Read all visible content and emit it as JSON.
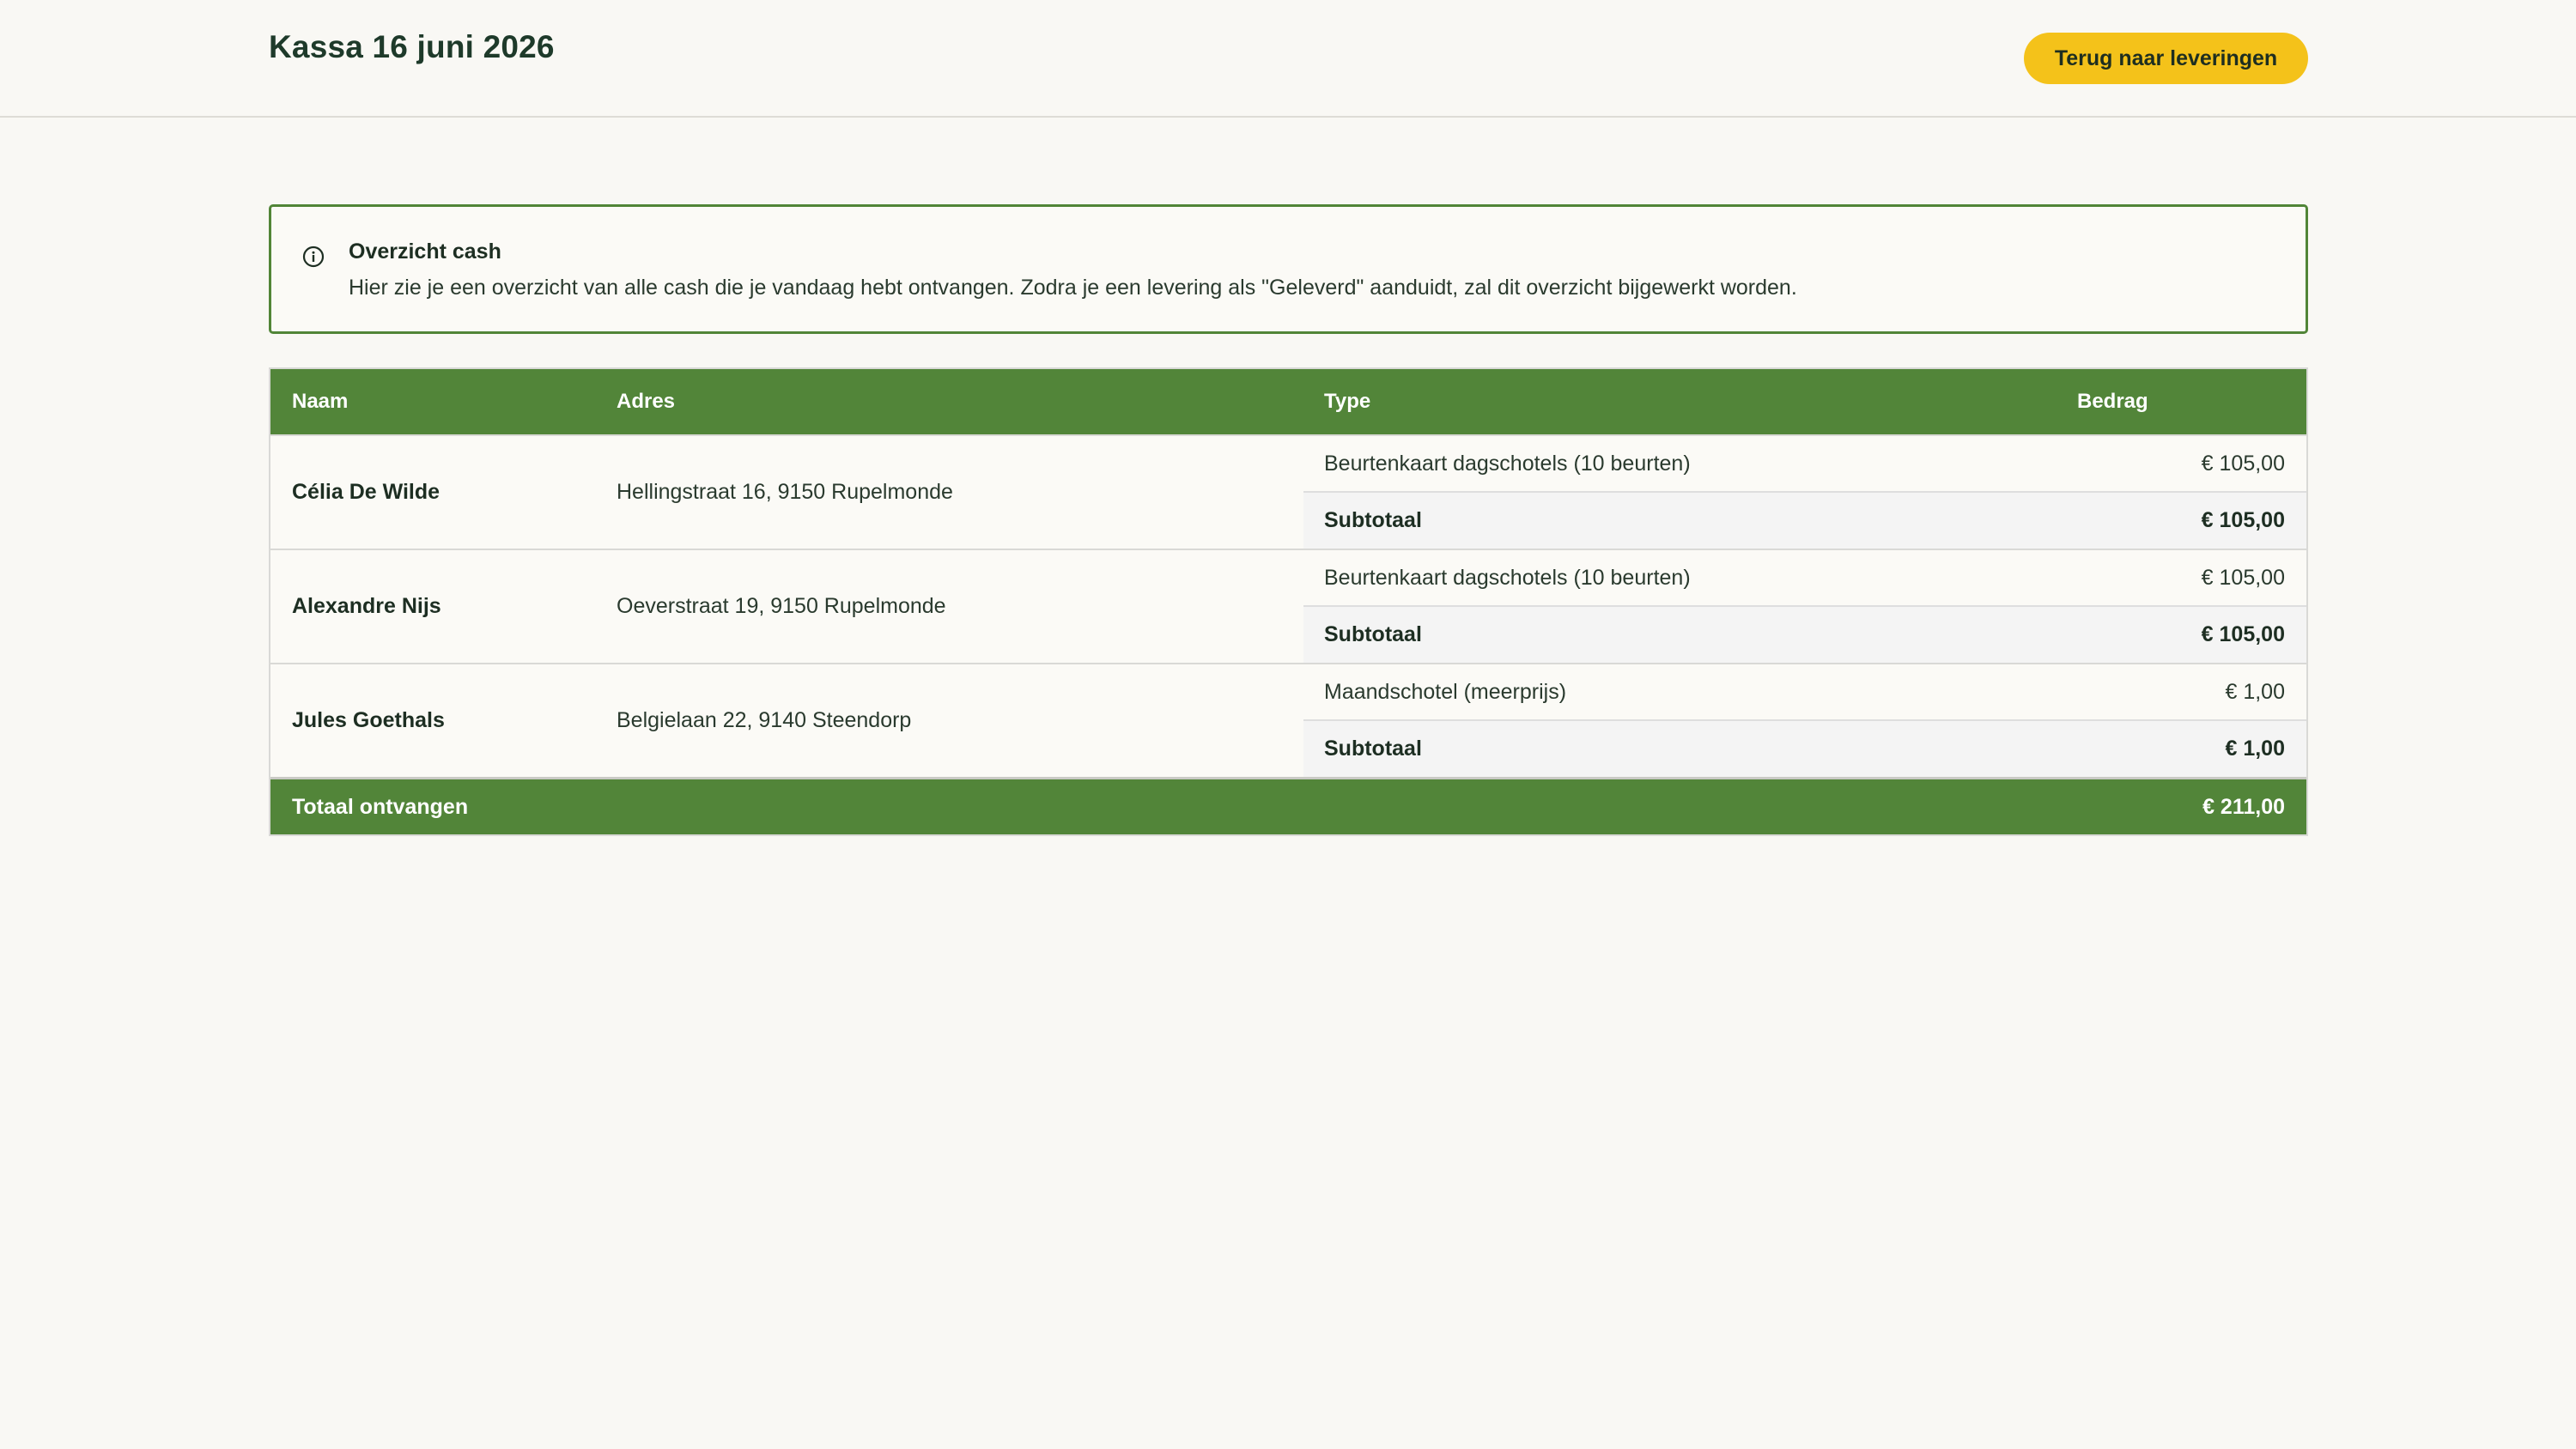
{
  "header": {
    "title": "Kassa 16 juni 2026",
    "back_button": "Terug naar leveringen"
  },
  "info": {
    "icon": "info-circle-icon",
    "title": "Overzicht cash",
    "text": "Hier zie je een overzicht van alle cash die je vandaag hebt ontvangen. Zodra je een levering als \"Geleverd\" aanduidt, zal dit overzicht bijgewerkt worden."
  },
  "table": {
    "columns": {
      "name": "Naam",
      "address": "Adres",
      "type": "Type",
      "amount": "Bedrag"
    },
    "groups": [
      {
        "name": "Célia De Wilde",
        "address": "Hellingstraat 16, 9150 Rupelmonde",
        "item_type": "Beurtenkaart dagschotels (10 beurten)",
        "item_amount": "€ 105,00",
        "subtotal_label": "Subtotaal",
        "subtotal_amount": "€ 105,00"
      },
      {
        "name": "Alexandre Nijs",
        "address": "Oeverstraat 19, 9150 Rupelmonde",
        "item_type": "Beurtenkaart dagschotels (10 beurten)",
        "item_amount": "€ 105,00",
        "subtotal_label": "Subtotaal",
        "subtotal_amount": "€ 105,00"
      },
      {
        "name": "Jules Goethals",
        "address": "Belgielaan 22, 9140 Steendorp",
        "item_type": "Maandschotel (meerprijs)",
        "item_amount": "€ 1,00",
        "subtotal_label": "Subtotaal",
        "subtotal_amount": "€ 1,00"
      }
    ],
    "total": {
      "label": "Totaal ontvangen",
      "amount": "€ 211,00"
    }
  },
  "colors": {
    "primary_green": "#528539",
    "accent_yellow": "#f4c21a",
    "background": "#f9f8f4"
  }
}
